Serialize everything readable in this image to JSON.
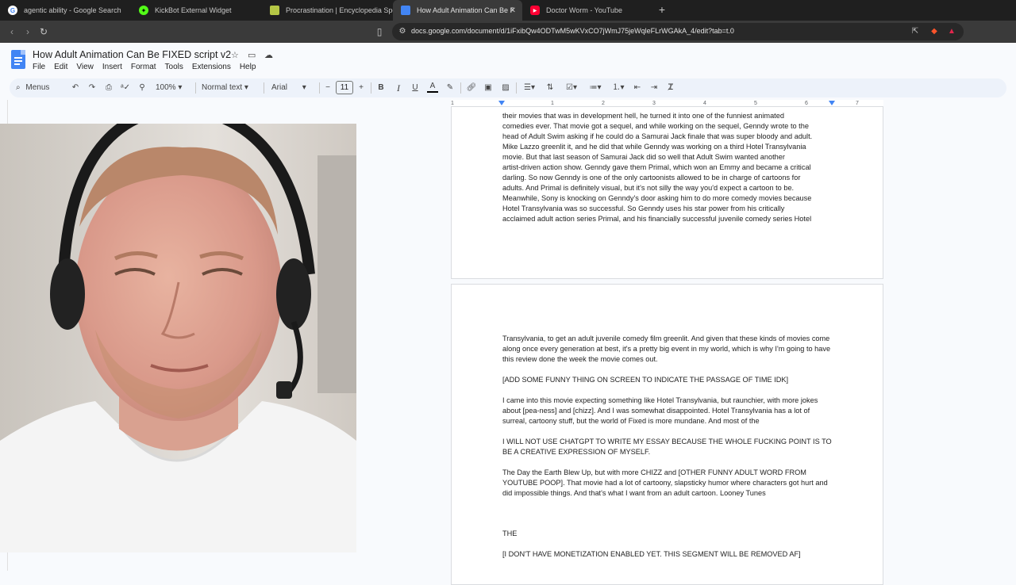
{
  "browser": {
    "tabs": [
      {
        "label": "agentic ability - Google Search",
        "icon": "google-icon",
        "active": false
      },
      {
        "label": "KickBot External Widget",
        "icon": "kickbot-icon",
        "active": false
      },
      {
        "label": "Procrastination | Encyclopedia Spong",
        "icon": "fandom-icon",
        "active": false
      },
      {
        "label": "How Adult Animation Can Be FIX",
        "icon": "docs-icon",
        "active": true
      },
      {
        "label": "Doctor Worm - YouTube",
        "icon": "youtube-icon",
        "active": false
      }
    ],
    "new_tab": "+",
    "url": "docs.google.com/document/d/1iFxibQw4ODTwM5wKVxCO7jWmJ75jeWqleFLrWGAkA_4/edit?tab=t.0"
  },
  "doc": {
    "title": "How Adult Animation Can Be FIXED script v2",
    "menus": [
      "File",
      "Edit",
      "View",
      "Insert",
      "Format",
      "Tools",
      "Extensions",
      "Help"
    ]
  },
  "toolbar": {
    "search": "Menus",
    "zoom": "100%",
    "style": "Normal text",
    "font": "Arial",
    "font_size": "11"
  },
  "ruler": [
    "1",
    "1",
    "2",
    "3",
    "4",
    "5",
    "6",
    "7"
  ],
  "page1_lines": [
    "their movies that was in development hell, he turned it into one of the funniest animated",
    "comedies ever. That movie got a sequel, and while working on the sequel, Genndy wrote to the",
    "head of Adult Swim asking if he could do a Samurai Jack finale that was super bloody and adult.",
    "Mike Lazzo greenlit it, and he did that while Genndy was working on a third Hotel Transylvania",
    "movie. But that last season of Samurai Jack did so well that Adult Swim wanted another",
    "artist-driven action show. Genndy gave them Primal, which won an Emmy and became a critical",
    "darling. So now Genndy is one of the only cartoonists allowed to be in charge of cartoons for",
    "adults. And Primal is definitely visual, but it's not silly the way you'd expect a cartoon to be.",
    "Meanwhile, Sony is knocking on Genndy's door asking him to do more comedy movies because",
    "Hotel Transylvania was so successful. So Genndy uses his star power from his critically",
    "acclaimed adult action series Primal, and his financially successful juvenile comedy series Hotel"
  ],
  "page2_paragraphs": [
    "Transylvania, to get an adult juvenile comedy film greenlit. And given that these kinds of movies come along once every generation at best, it's a pretty big event in my world, which is why I'm going to have this review done the week the movie comes out.",
    "[ADD SOME FUNNY THING ON SCREEN TO INDICATE THE PASSAGE OF TIME IDK]",
    "I came into this movie expecting something like Hotel Transylvania, but raunchier, with more jokes about [pea-ness] and [chizz]. And I was somewhat disappointed. Hotel Transylvania has a lot of surreal, cartoony stuff, but the world of Fixed is more mundane. And most of the",
    "I WILL NOT USE CHATGPT TO WRITE MY ESSAY BECAUSE THE WHOLE FUCKING POINT IS TO BE A CREATIVE EXPRESSION OF MYSELF.",
    "The Day the Earth Blew Up, but with more CHIZZ and [OTHER FUNNY ADULT WORD FROM YOUTUBE POOP]. That movie had a lot of cartoony, slapsticky humor where characters got hurt and did impossible things. And that's what I want from an adult cartoon. Looney Tunes",
    "THE",
    "[I DON'T HAVE MONETIZATION ENABLED YET. THIS SEGMENT WILL BE REMOVED AF]"
  ],
  "colors": {
    "accent": "#4285f4",
    "tab_bg": "#1f1f1f",
    "chrome_bg": "#3a3a3a",
    "docs_bg": "#f8fafd"
  }
}
